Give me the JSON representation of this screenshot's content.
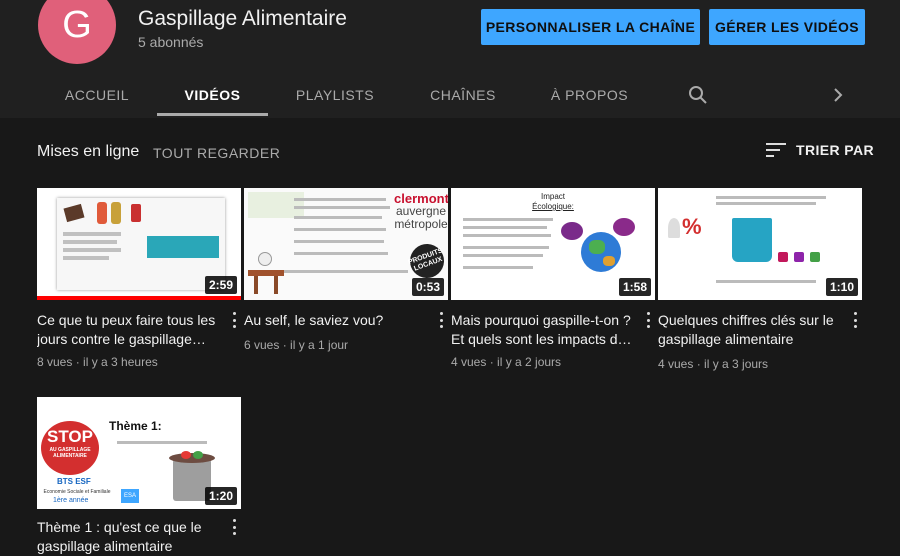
{
  "channel": {
    "avatar_letter": "G",
    "name": "Gaspillage Alimentaire",
    "subscribers": "5 abonnés",
    "customize_label": "PERSONNALISER LA CHAÎNE",
    "manage_label": "GÉRER LES VIDÉOS"
  },
  "tabs": [
    "ACCUEIL",
    "VIDÉOS",
    "PLAYLISTS",
    "CHAÎNES",
    "À PROPOS"
  ],
  "icons": {
    "search": "search-icon",
    "next": "chevron-right-icon",
    "sort": "sort-icon",
    "menu": "more-vert-icon"
  },
  "shelf": {
    "title": "Mises en ligne",
    "play_all": "TOUT REGARDER",
    "sort_label": "TRIER PAR"
  },
  "videos": [
    {
      "title": "Ce que tu peux faire tous les jours contre le gaspillage alimentaire",
      "views": "8 vues",
      "age": "il y a 3 heures",
      "duration": "2:59",
      "watched_fraction": 1.0
    },
    {
      "title": "Au self, le saviez vou?",
      "views": "6 vues",
      "age": "il y a 1 jour",
      "duration": "0:53",
      "thumb_text": [
        "clermont",
        "auvergne",
        "métropole",
        "PRODUITS LOCAUX"
      ]
    },
    {
      "title": "Mais pourquoi gaspille-t-on ? Et quels sont les impacts du gaspillage",
      "views": "4 vues",
      "age": "il y a 2 jours",
      "duration": "1:58",
      "thumb_text": [
        "Impact",
        "Écologique:"
      ]
    },
    {
      "title": "Quelques chiffres clés sur le gaspillage alimentaire",
      "views": "4 vues",
      "age": "il y a 3 jours",
      "duration": "1:10"
    },
    {
      "title": "Thème 1 : qu'est ce que le gaspillage alimentaire",
      "views": "",
      "age": "",
      "duration": "1:20",
      "thumb_text": [
        "Thème 1:",
        "STOP",
        "AU GASPILLAGE ALIMENTAIRE",
        "BTS ESF",
        "Economie Sociale et Familiale",
        "1ère année",
        "ESA"
      ]
    }
  ],
  "colors": {
    "accent": "#3ea6ff",
    "background": "#181818",
    "header": "#202020",
    "progress": "#ff0000"
  }
}
